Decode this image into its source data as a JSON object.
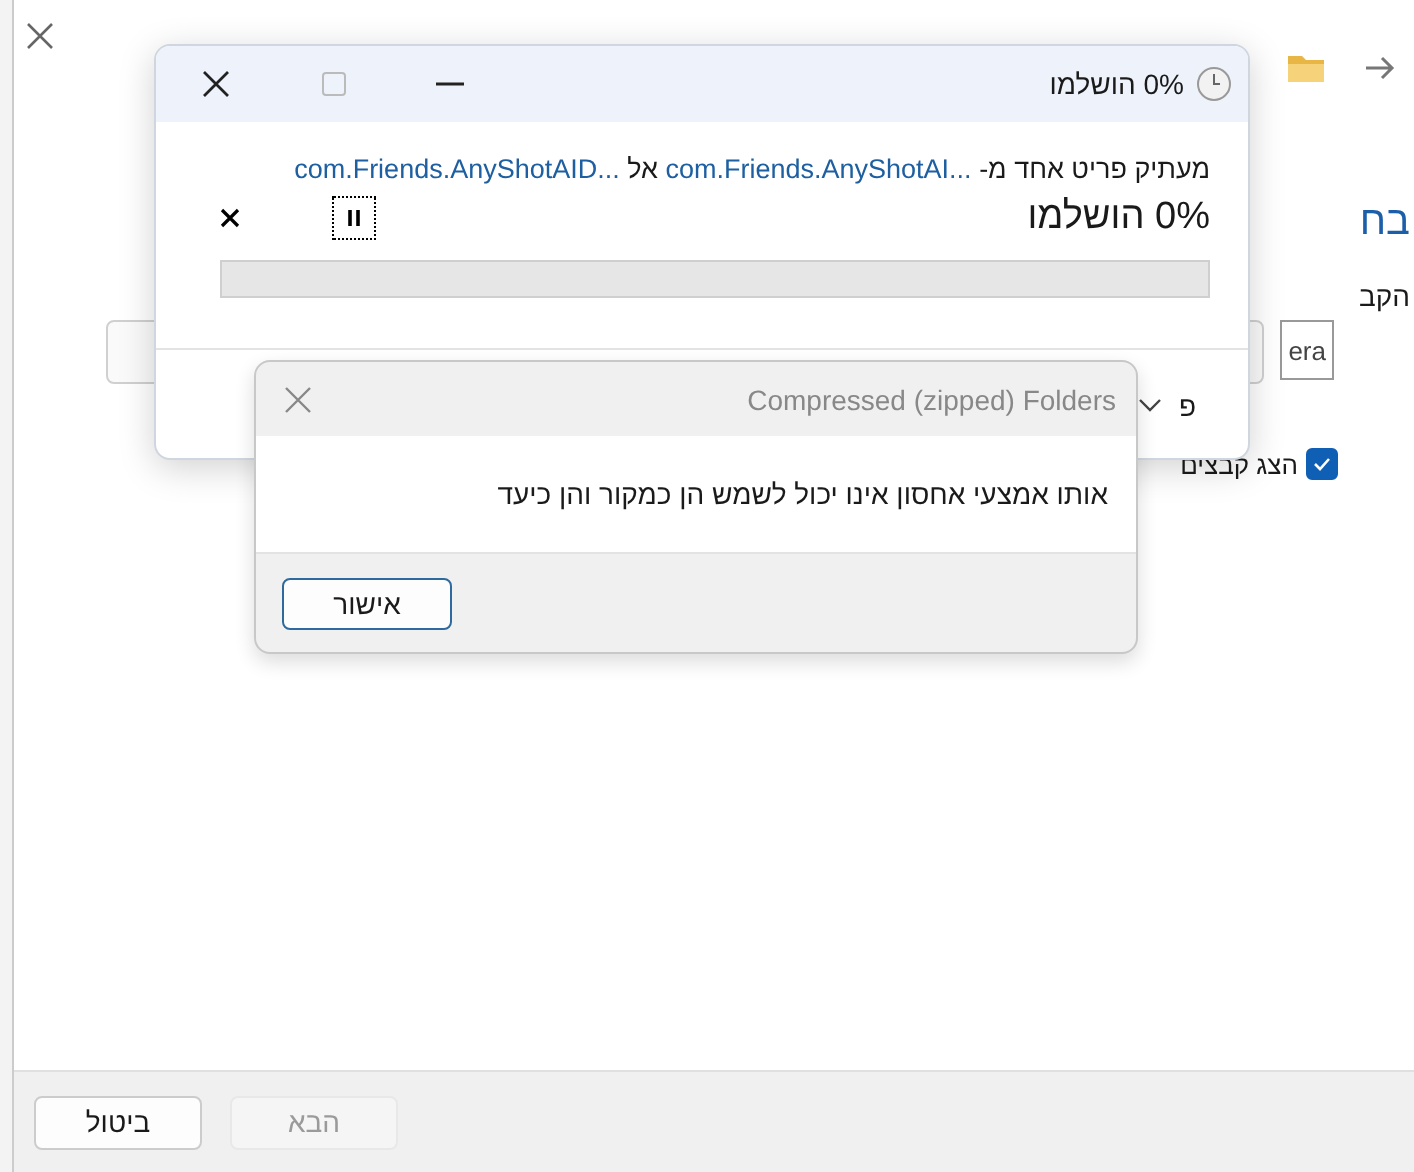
{
  "wizard": {
    "heading": "בח",
    "field_label": "הקב",
    "field_value_fragment": "era",
    "checkbox": {
      "label": "הצג קבצים",
      "checked": true
    },
    "buttons": [
      {
        "label": "הבא",
        "disabled": true
      },
      {
        "label": "ביטול",
        "disabled": false
      }
    ]
  },
  "progress_dialog": {
    "title": "0% הושלמו",
    "controls": [
      {
        "kind": "minimize",
        "disabled": false
      },
      {
        "kind": "maximize",
        "disabled": true
      },
      {
        "kind": "close",
        "disabled": false
      }
    ],
    "copy_line": {
      "prefix": "מעתיק פריט אחד מ-",
      "source": "com.Friends.AnyShotAI...",
      "middle": "אל",
      "destination": "com.Friends.AnyShotAID..."
    },
    "status": "0% הושלמו",
    "progress": {
      "level": 0
    },
    "details_fragment": "פ"
  },
  "message_box": {
    "title": "Compressed (zipped) Folders",
    "message": "אותו אמצעי אחסון אינו יכול לשמש הן כמקור והן כיעד",
    "buttons": [
      "אישור"
    ]
  }
}
